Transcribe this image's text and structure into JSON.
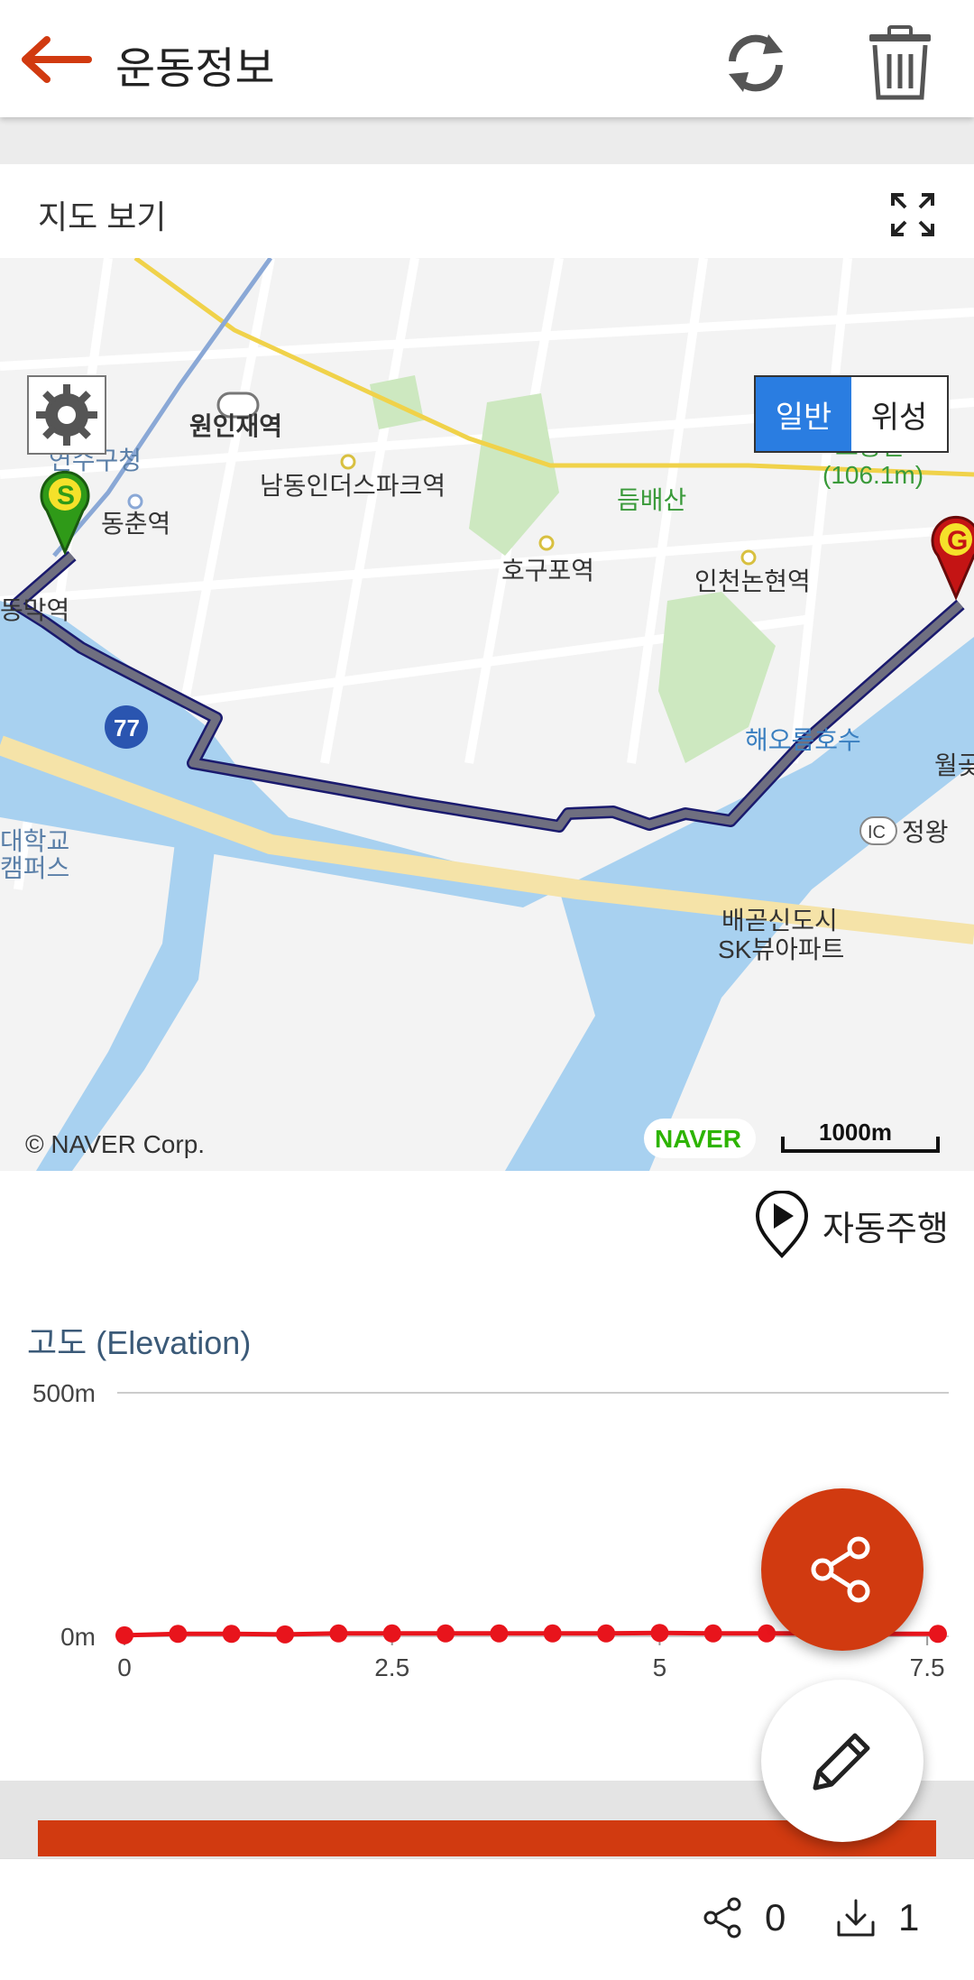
{
  "header": {
    "title": "운동정보"
  },
  "map": {
    "section_label": "지도 보기",
    "map_type_options": [
      "일반",
      "위성"
    ],
    "selected_map_type": "일반",
    "place_labels": {
      "wonin": "원인재역",
      "yeonsu_office": "연수구청",
      "dongchun": "동춘역",
      "namdong": "남동인더스파크역",
      "deumbaesan": "듬배산",
      "obongsan": "오봉산",
      "obongsan_height": "(106.1m)",
      "hogupo": "호구포역",
      "incheon_nonhyeon": "인천논현역",
      "haeodeum": "해오름호수",
      "wolgot": "월곶",
      "dong_station": "동막역",
      "route77": "77",
      "univ": "대학교",
      "campus": "캠퍼스",
      "ic": "IC",
      "jeongwang": "정왕",
      "baegot1": "배곧신도시",
      "baegot2": "SK뷰아파트"
    },
    "start_marker": "S",
    "goal_marker": "G",
    "copyright": "© NAVER Corp.",
    "brand": "NAVER",
    "scale": "1000m",
    "colors": {
      "water": "#a8d1f0",
      "route": "#6f6f80",
      "route_outline": "#1a1a6e",
      "subway": "#f0d24a",
      "park": "#cde8c0"
    }
  },
  "autoplay": {
    "label": "자동주행"
  },
  "elevation": {
    "title": "고도 (Elevation)",
    "chart_data": {
      "type": "line",
      "title": "고도 (Elevation)",
      "xlabel": "",
      "ylabel": "",
      "x": [
        0,
        0.5,
        1.0,
        1.5,
        2.0,
        2.5,
        3.0,
        3.5,
        4.0,
        4.5,
        5.0,
        5.5,
        6.0,
        6.5,
        7.0,
        7.6
      ],
      "series": [
        {
          "values": [
            2,
            5,
            5,
            4,
            6,
            6,
            6,
            6,
            6,
            6,
            7,
            6,
            6,
            6,
            5,
            5
          ]
        }
      ],
      "y_tick_labels": [
        "500m",
        "0m"
      ],
      "x_tick_labels": [
        "0",
        "2.5",
        "5",
        "7.5"
      ],
      "ylim": [
        0,
        500
      ],
      "xlim": [
        0,
        7.6
      ],
      "grid": true,
      "colors": {
        "line": "#e8141c"
      }
    }
  },
  "footer": {
    "share_count": "0",
    "download_count": "1"
  }
}
